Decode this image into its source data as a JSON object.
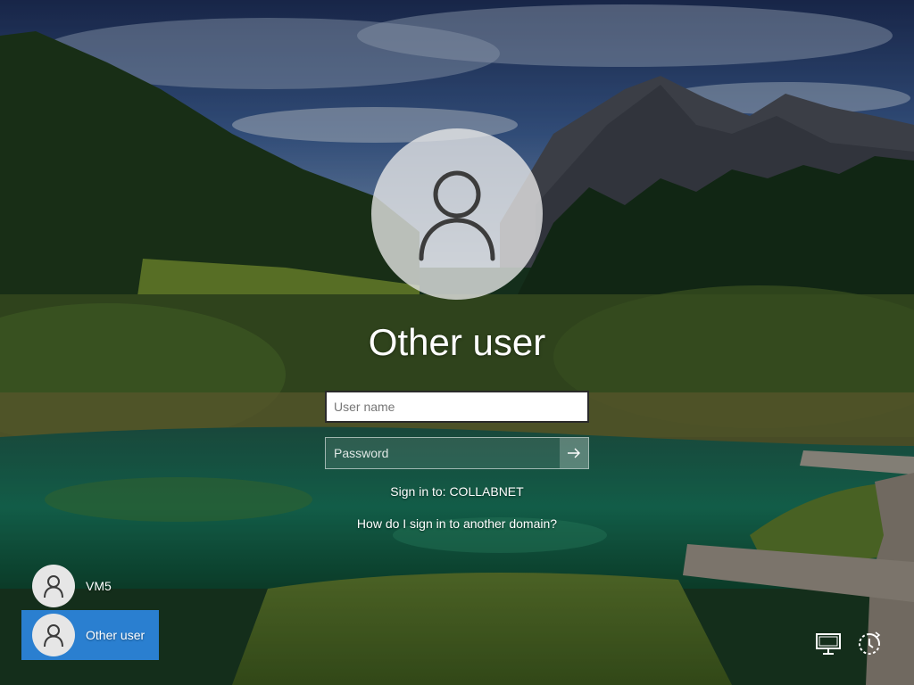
{
  "login": {
    "display_name": "Other user",
    "username_placeholder": "User name",
    "password_placeholder": "Password",
    "signin_to": "Sign in to: COLLABNET",
    "domain_help_link": "How do I sign in to another domain?"
  },
  "user_list": [
    {
      "label": "VM5",
      "selected": false
    },
    {
      "label": "Other user",
      "selected": true
    }
  ],
  "corner_icons": [
    "network-icon",
    "ease-of-access-power-icon"
  ],
  "colors": {
    "selected_tile": "#2a7fd0",
    "avatar_bg": "#e8e8e8",
    "avatar_glyph": "#3c3c3c"
  }
}
